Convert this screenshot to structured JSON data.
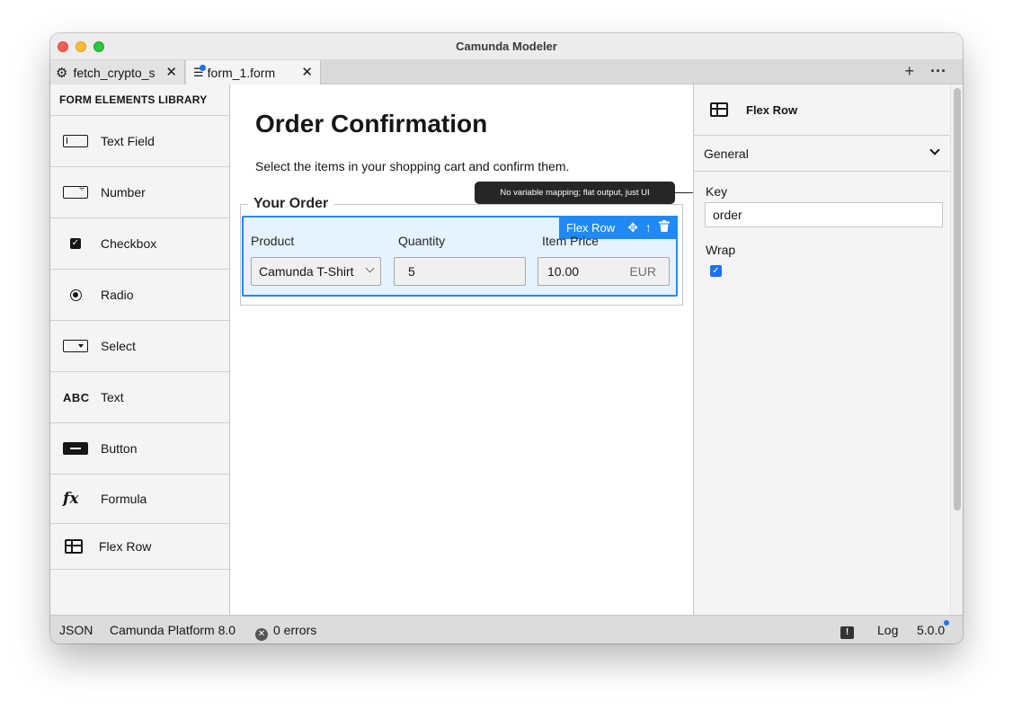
{
  "window": {
    "title": "Camunda Modeler"
  },
  "tabs": [
    {
      "label": "fetch_crypto_s",
      "icon": "gear-icon"
    },
    {
      "label": "form_1.form",
      "icon": "form-icon",
      "dirty": true
    }
  ],
  "tab_actions": {
    "add": "+",
    "more": "···"
  },
  "library": {
    "heading": "FORM ELEMENTS LIBRARY",
    "items": [
      {
        "label": "Text Field",
        "icon": "text-field-icon"
      },
      {
        "label": "Number",
        "icon": "number-icon"
      },
      {
        "label": "Checkbox",
        "icon": "checkbox-icon"
      },
      {
        "label": "Radio",
        "icon": "radio-icon"
      },
      {
        "label": "Select",
        "icon": "select-icon"
      },
      {
        "label": "Text",
        "icon": "text-icon",
        "glyph": "ABC"
      },
      {
        "label": "Button",
        "icon": "button-icon"
      },
      {
        "label": "Formula",
        "icon": "formula-icon",
        "glyph": "fx"
      },
      {
        "label": "Flex Row",
        "icon": "flex-row-icon"
      }
    ]
  },
  "form": {
    "title": "Order Confirmation",
    "description": "Select the items in your shopping cart and confirm them.",
    "group_label": "Your Order",
    "flexrow_toolbar_label": "Flex Row",
    "fields": {
      "product": {
        "label": "Product",
        "value": "Camunda T-Shirt"
      },
      "quantity": {
        "label": "Quantity",
        "value": "5"
      },
      "price": {
        "label": "Item Price",
        "value": "10.00",
        "suffix": "EUR"
      }
    },
    "tooltip": "No variable mapping; flat output, just UI"
  },
  "properties": {
    "title": "Flex Row",
    "group": "General",
    "key_label": "Key",
    "key_value": "order",
    "wrap_label": "Wrap",
    "wrap_checked": true
  },
  "status": {
    "format": "JSON",
    "platform": "Camunda Platform 8.0",
    "errors": "0 errors",
    "log": "Log",
    "version": "5.0.0"
  },
  "colors": {
    "accent": "#1f8af5",
    "selection_bg": "#e5f2ff",
    "dirty_dot": "#1f70f5"
  }
}
